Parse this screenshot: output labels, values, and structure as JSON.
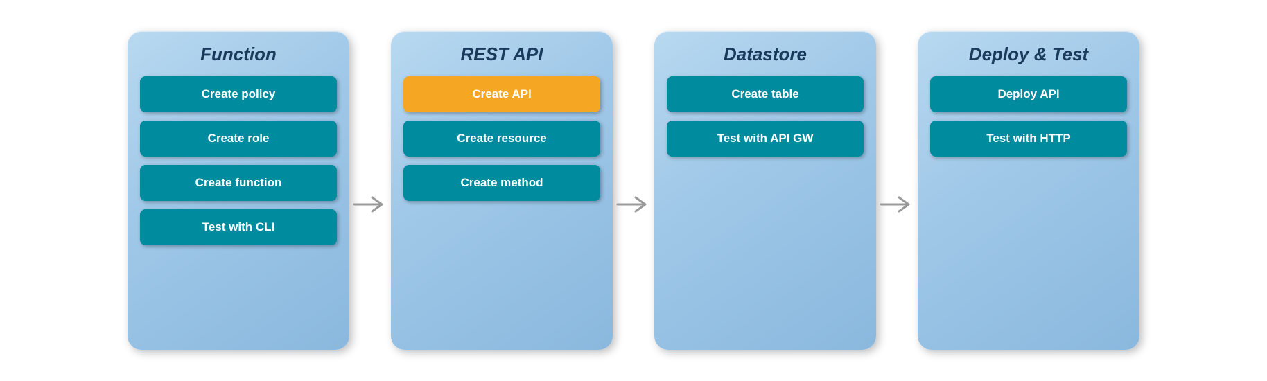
{
  "panels": [
    {
      "id": "function",
      "title": "Function",
      "items": [
        {
          "label": "Create policy",
          "active": false
        },
        {
          "label": "Create role",
          "active": false
        },
        {
          "label": "Create function",
          "active": false
        },
        {
          "label": "Test with CLI",
          "active": false
        }
      ]
    },
    {
      "id": "rest-api",
      "title": "REST API",
      "items": [
        {
          "label": "Create API",
          "active": true
        },
        {
          "label": "Create resource",
          "active": false
        },
        {
          "label": "Create method",
          "active": false
        }
      ]
    },
    {
      "id": "datastore",
      "title": "Datastore",
      "items": [
        {
          "label": "Create table",
          "active": false
        },
        {
          "label": "Test with API GW",
          "active": false
        }
      ]
    },
    {
      "id": "deploy-test",
      "title": "Deploy & Test",
      "items": [
        {
          "label": "Deploy API",
          "active": false
        },
        {
          "label": "Test with HTTP",
          "active": false
        }
      ]
    }
  ],
  "arrows": [
    {
      "id": "arrow-1"
    },
    {
      "id": "arrow-2"
    },
    {
      "id": "arrow-3"
    }
  ]
}
